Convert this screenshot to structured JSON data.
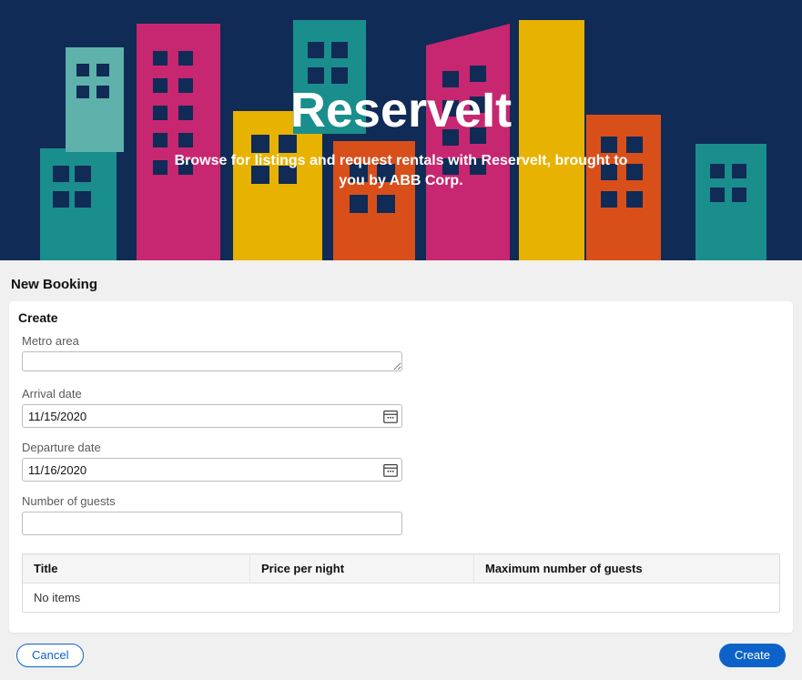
{
  "hero": {
    "title": "ReserveIt",
    "subtitle": "Browse for listings and request rentals with ReserveIt, brought to you by ABB Corp."
  },
  "page_title": "New Booking",
  "card_title": "Create",
  "form": {
    "metro_label": "Metro area",
    "metro_value": "",
    "arrival_label": "Arrival date",
    "arrival_value": "11/15/2020",
    "departure_label": "Departure date",
    "departure_value": "11/16/2020",
    "guests_label": "Number of guests",
    "guests_value": ""
  },
  "table": {
    "col_title": "Title",
    "col_price": "Price per night",
    "col_max": "Maximum number of guests",
    "empty": "No items"
  },
  "footer": {
    "cancel": "Cancel",
    "create": "Create"
  },
  "colors": {
    "hero_bg": "#0f2b56",
    "primary": "#0d62c9",
    "teal": "#1a8e8c",
    "magenta": "#c72770",
    "yellow": "#e8b200",
    "orange": "#d94f1a"
  }
}
